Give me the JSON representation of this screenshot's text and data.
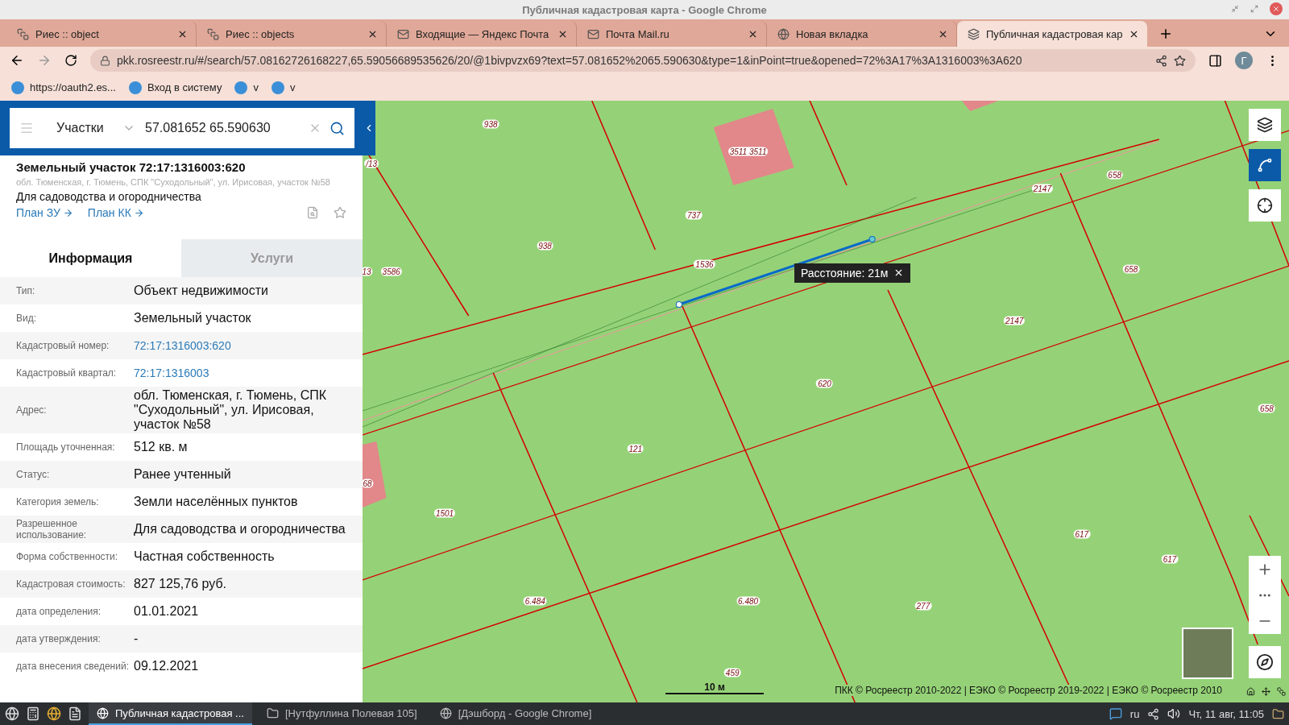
{
  "window": {
    "title": "Публичная кадастровая карта - Google Chrome"
  },
  "tabs": [
    {
      "title": "Риес :: object",
      "selected": false
    },
    {
      "title": "Риес :: objects",
      "selected": false
    },
    {
      "title": "Входящие — Яндекс Почта",
      "selected": false
    },
    {
      "title": "Почта Mail.ru",
      "selected": false
    },
    {
      "title": "Новая вкладка",
      "selected": false
    },
    {
      "title": "Публичная кадастровая кар",
      "selected": true
    }
  ],
  "address_bar": {
    "url": "pkk.rosreestr.ru/#/search/57.08162726168227,65.59056689535626/20/@1bivpvzx69?text=57.081652%2065.590630&type=1&inPoint=true&opened=72%3A17%3A1316003%3A620",
    "profile": "Г"
  },
  "bookmarks": [
    "https://oauth2.es...",
    "Вход в систему",
    "v",
    "v"
  ],
  "search": {
    "category": "Участки",
    "value": "57.081652 65.590630"
  },
  "parcel": {
    "title": "Земельный участок 72:17:1316003:620",
    "address": "обл. Тюменская, г. Тюмень, СПК \"Суходольный\", ул. Ирисовая, участок №58",
    "purpose": "Для садоводства и огородничества",
    "links": [
      "План ЗУ",
      "План КК"
    ]
  },
  "info_tabs": [
    {
      "label": "Информация",
      "selected": true
    },
    {
      "label": "Услуги",
      "selected": false
    }
  ],
  "properties": [
    {
      "label": "Тип:",
      "value": "Объект недвижимости",
      "kind": "text"
    },
    {
      "label": "Вид:",
      "value": "Земельный участок",
      "kind": "text"
    },
    {
      "label": "Кадастровый номер:",
      "value": "72:17:1316003:620",
      "kind": "link"
    },
    {
      "label": "Кадастровый квартал:",
      "value": "72:17:1316003",
      "kind": "link"
    },
    {
      "label": "Адрес:",
      "value": "обл. Тюменская, г. Тюмень, СПК \"Суходольный\", ул. Ирисовая, участок №58",
      "kind": "text"
    },
    {
      "label": "Площадь уточненная:",
      "value": "512 кв. м",
      "kind": "text"
    },
    {
      "label": "Статус:",
      "value": "Ранее учтенный",
      "kind": "text"
    },
    {
      "label": "Категория земель:",
      "value": "Земли населённых пунктов",
      "kind": "text"
    },
    {
      "label": "Разрешенное использование:",
      "value": "Для садоводства и огородничества",
      "kind": "text"
    },
    {
      "label": "Форма собственности:",
      "value": "Частная собственность",
      "kind": "text"
    },
    {
      "label": "Кадастровая стоимость:",
      "value": "827 125,76 руб.",
      "kind": "text"
    },
    {
      "label": "дата определения:",
      "value": "01.01.2021",
      "kind": "text"
    },
    {
      "label": "дата утверждения:",
      "value": "-",
      "kind": "text"
    },
    {
      "label": "дата внесения сведений:",
      "value": "09.12.2021",
      "kind": "text"
    }
  ],
  "map": {
    "labels": [
      "938",
      "3511 3511",
      "737",
      "938",
      "1536",
      "3586",
      "2147",
      "658",
      "658",
      "2147",
      "620",
      "658",
      "121",
      "1501",
      "617",
      "617",
      "6.484",
      "6.480",
      "277",
      "459",
      "/13",
      "13",
      "68"
    ],
    "tooltip": "Расстояние: 21м",
    "scale": "10 м",
    "attribution": "ПКК © Росреестр 2010-2022 | ЕЭКО © Росреестр 2019-2022 | ЕЭКО © Росреестр 2010"
  },
  "taskbar": {
    "windows": [
      {
        "title": "Публичная кадастровая ...",
        "selected": true
      },
      {
        "title": "[Нутфуллина Полевая 105]",
        "selected": false
      },
      {
        "title": "[Дэшборд - Google Chrome]",
        "selected": false
      }
    ],
    "language": "ru",
    "clock": "Чт, 11 авг, 11:05"
  }
}
